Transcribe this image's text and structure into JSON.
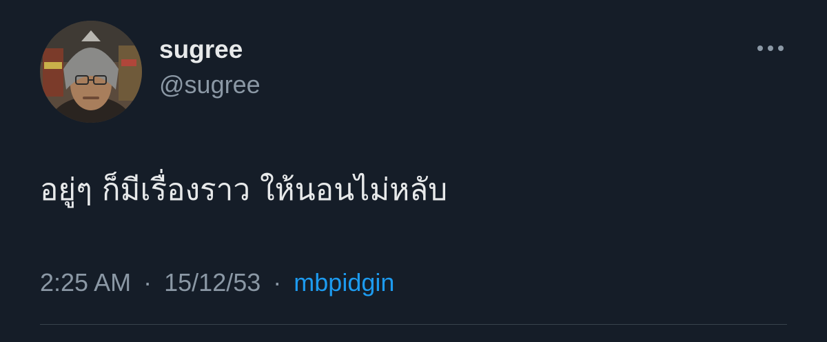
{
  "author": {
    "display_name": "sugree",
    "handle": "@sugree"
  },
  "tweet": {
    "text": "อยู่ๆ ก็มีเรื่องราว ให้นอนไม่หลับ",
    "time": "2:25 AM",
    "date": "15/12/53",
    "separator": "·",
    "source": "mbpidgin"
  },
  "icons": {
    "more": "more-horizontal-icon"
  },
  "colors": {
    "background": "#151d28",
    "primary_text": "#e7e9ea",
    "secondary_text": "#8b98a5",
    "link": "#1d9bf0",
    "divider": "#38444d"
  }
}
